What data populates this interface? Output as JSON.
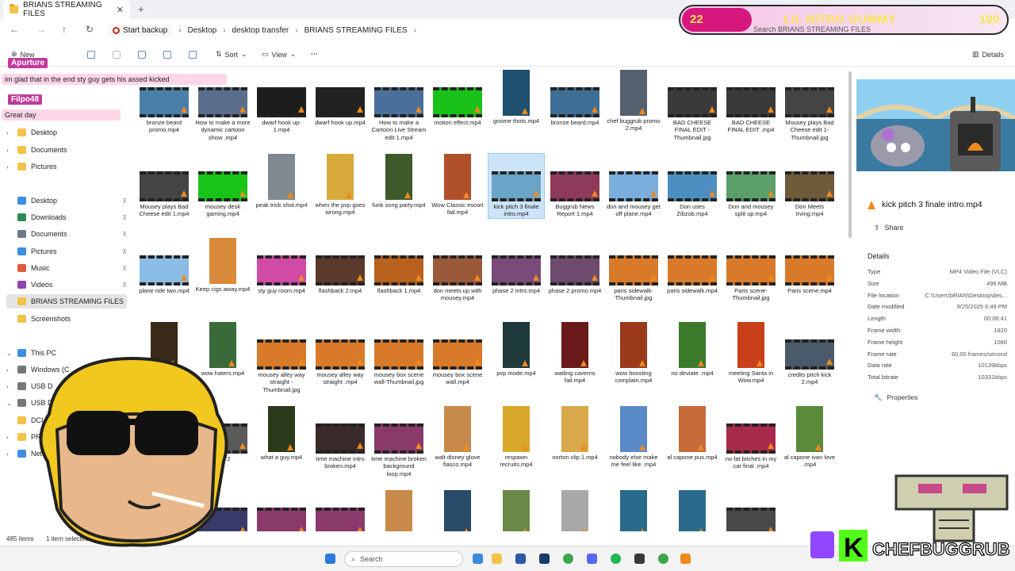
{
  "window": {
    "tab_title": "BRIANS STREAMING FILES",
    "close_glyph": "✕",
    "new_tab_glyph": "+"
  },
  "nav": {
    "back": "←",
    "forward": "→",
    "up": "↑",
    "refresh": "↻"
  },
  "breadcrumb": {
    "backup_label": "Start backup",
    "items": [
      "Desktop",
      "desktop transfer",
      "BRIANS STREAMING FILES"
    ],
    "sep": "›"
  },
  "toolbar": {
    "new_label": "New",
    "sort_label": "Sort",
    "view_label": "View",
    "more_label": "···",
    "details_label": "Details"
  },
  "overlay": {
    "gummy_left_num": "22",
    "gummy_title": "LIL NITRO GUMMY",
    "gummy_right_num": "100",
    "search_placeholder": "Search BRIANS STREAMING FILES",
    "chat": [
      {
        "user": "Apurture",
        "message": "im glad that in the end sty guy gets his assed kicked"
      },
      {
        "user": "Filpo48",
        "message": "Great day"
      }
    ],
    "brand": "CHEFBUGGRUB",
    "brand_k": "K"
  },
  "sidebar": {
    "items": [
      {
        "label": "Desktop",
        "chev": "›",
        "icon_color": "#f3c24a"
      },
      {
        "label": "Documents",
        "chev": "›",
        "icon_color": "#f3c24a"
      },
      {
        "label": "Pictures",
        "chev": "›",
        "icon_color": "#f3c24a"
      },
      {
        "label": "Desktop",
        "chev": "",
        "icon_color": "#3d8ee0",
        "pin": "📌"
      },
      {
        "label": "Downloads",
        "chev": "",
        "icon_color": "#2e8b57",
        "pin": "📌"
      },
      {
        "label": "Documents",
        "chev": "",
        "icon_color": "#6a7a8a",
        "pin": "📌"
      },
      {
        "label": "Pictures",
        "chev": "",
        "icon_color": "#3d8ee0",
        "pin": "📌"
      },
      {
        "label": "Music",
        "chev": "",
        "icon_color": "#e05a3d",
        "pin": "📌"
      },
      {
        "label": "Videos",
        "chev": "",
        "icon_color": "#8e44ad",
        "pin": "📌"
      },
      {
        "label": "BRIANS STREAMING FILES",
        "chev": "",
        "icon_color": "#f3c24a",
        "pin": ""
      },
      {
        "label": "Screenshots",
        "chev": "",
        "icon_color": "#f3c24a",
        "pin": ""
      },
      {
        "label": "This PC",
        "chev": "⌄",
        "icon_color": "#3d8ee0",
        "pin": ""
      },
      {
        "label": "Windows (C",
        "chev": "›",
        "icon_color": "#777777",
        "pin": ""
      },
      {
        "label": "USB D",
        "chev": "›",
        "icon_color": "#777777",
        "pin": ""
      },
      {
        "label": "USB D",
        "chev": "⌄",
        "icon_color": "#777777",
        "pin": ""
      },
      {
        "label": "DCI",
        "chev": "",
        "icon_color": "#f3c24a",
        "pin": ""
      },
      {
        "label": "PR",
        "chev": "›",
        "icon_color": "#f3c24a",
        "pin": ""
      },
      {
        "label": "Netw",
        "chev": "›",
        "icon_color": "#3d8ee0",
        "pin": ""
      }
    ]
  },
  "files": [
    {
      "name": "bronze beard promo.mp4",
      "color": "#4a7fa8",
      "tall": false
    },
    {
      "name": "How to make a more dynamic cartoon show .mp4",
      "color": "#5a6e8c",
      "tall": false
    },
    {
      "name": "dwarf hook up-1.mp4",
      "color": "#1d1d1d",
      "tall": false
    },
    {
      "name": "dwarf hook up.mp4",
      "color": "#222222",
      "tall": false
    },
    {
      "name": "How to make a Cartoon Live Stream edit 1.mp4",
      "color": "#4a6f9a",
      "tall": false
    },
    {
      "name": "motion effect.mp4",
      "color": "#19c219",
      "tall": false
    },
    {
      "name": "gnome thots.mp4",
      "color": "#1e4f6e",
      "tall": true
    },
    {
      "name": "bronze beard.mp4",
      "color": "#3d6f96",
      "tall": false
    },
    {
      "name": "chef buggrub promo 2.mp4",
      "color": "#55606e",
      "tall": true
    },
    {
      "name": "BAD CHEESE FINAL EDIT -Thumbnail.jpg",
      "color": "#3a3a3a",
      "tall": false
    },
    {
      "name": "BAD CHEESE FINAL EDIT .mp4",
      "color": "#3a3a3a",
      "tall": false
    },
    {
      "name": "Mousey plays Bad Cheese edit 1-Thumbnail.jpg",
      "color": "#444444",
      "tall": false
    },
    {
      "name": "Mousey plays Bad Cheese edit 1.mp4",
      "color": "#444444",
      "tall": false
    },
    {
      "name": "mousey desk gaming.mp4",
      "color": "#18c418",
      "tall": false
    },
    {
      "name": "peak trick shot.mp4",
      "color": "#7e8a90",
      "tall": true
    },
    {
      "name": "when the pvp goes wrong.mp4",
      "color": "#d6a93a",
      "tall": true
    },
    {
      "name": "funk song party.mp4",
      "color": "#3e5a2a",
      "tall": true
    },
    {
      "name": "Wow Classic escort fail.mp4",
      "color": "#b0502a",
      "tall": true
    },
    {
      "name": "kick pitch 3 finale intro.mp4",
      "color": "#6aa4c8",
      "tall": false
    },
    {
      "name": "Buggrub News Report 1.mp4",
      "color": "#8e3a5a",
      "tall": false
    },
    {
      "name": "don and mousey get off plane.mp4",
      "color": "#7aaedc",
      "tall": false
    },
    {
      "name": "Don uses Zibzob.mp4",
      "color": "#4d8fc0",
      "tall": false
    },
    {
      "name": "Don and mousey split up.mp4",
      "color": "#5a9f6a",
      "tall": false
    },
    {
      "name": "Don Meets Irving.mp4",
      "color": "#6e5a3a",
      "tall": false
    },
    {
      "name": "plane ride two.mp4",
      "color": "#8abce6",
      "tall": false
    },
    {
      "name": "Keep cigs away.mp4",
      "color": "#d88a3a",
      "tall": true
    },
    {
      "name": "sty guy room.mp4",
      "color": "#d04aa6",
      "tall": false
    },
    {
      "name": "flashback 2.mp4",
      "color": "#5a3a2a",
      "tall": false
    },
    {
      "name": "flashback 1.mp4",
      "color": "#b8601e",
      "tall": false
    },
    {
      "name": "don meets up with mousey.mp4",
      "color": "#9a5a3a",
      "tall": false
    },
    {
      "name": "phase 2 intro.mp4",
      "color": "#7a4a7a",
      "tall": false
    },
    {
      "name": "phase 2 promo.mp4",
      "color": "#6e4a6e",
      "tall": false
    },
    {
      "name": "paris sidewalk-Thumbnail.jpg",
      "color": "#d87a2a",
      "tall": false
    },
    {
      "name": "paris sidewalk.mp4",
      "color": "#d87a2a",
      "tall": false
    },
    {
      "name": "Paris scene-Thumbnail.jpg",
      "color": "#d87a2a",
      "tall": false
    },
    {
      "name": "Paris scene.mp4",
      "color": "#d87a2a",
      "tall": false
    },
    {
      "name": "",
      "color": "#3a2a1a",
      "tall": true
    },
    {
      "name": "wow haters.mp4",
      "color": "#3a6a3a",
      "tall": true
    },
    {
      "name": "mousey alley way straight -Thumbnail.jpg",
      "color": "#d87a2a",
      "tall": false
    },
    {
      "name": "mousey alley way straight .mp4",
      "color": "#d87a2a",
      "tall": false
    },
    {
      "name": "mousey box scene wall-Thumbnail.jpg",
      "color": "#d87a2a",
      "tall": false
    },
    {
      "name": "mousey box scene wall.mp4",
      "color": "#d87a2a",
      "tall": false
    },
    {
      "name": "pvp mode.mp4",
      "color": "#1e3a3a",
      "tall": true
    },
    {
      "name": "wailing caverns fail.mp4",
      "color": "#6a1a1a",
      "tall": true
    },
    {
      "name": "wow boosting complain.mp4",
      "color": "#9a3a1a",
      "tall": true
    },
    {
      "name": "no deviate .mp4",
      "color": "#3a7a2a",
      "tall": true
    },
    {
      "name": "meeting Santa in Wow.mp4",
      "color": "#c8401a",
      "tall": true
    },
    {
      "name": "credits pitch kick 2.mp4",
      "color": "#4a5a6a",
      "tall": false
    },
    {
      "name": "",
      "color": "#3a3a3a",
      "tall": true
    },
    {
      "name": "kick 2",
      "color": "#5a5a5a",
      "tall": false
    },
    {
      "name": "what a guy.mp4",
      "color": "#2a3a1a",
      "tall": true
    },
    {
      "name": "time machine intro broken.mp4",
      "color": "#3a2a2a",
      "tall": false
    },
    {
      "name": "time machine broken background loop.mp4",
      "color": "#8a3a6a",
      "tall": false
    },
    {
      "name": "walt disney glove fiasco.mp4",
      "color": "#c88a4a",
      "tall": true
    },
    {
      "name": "respawn recruits.mp4",
      "color": "#d8a82a",
      "tall": true
    },
    {
      "name": "norton clip 1.mp4",
      "color": "#d8a84a",
      "tall": true
    },
    {
      "name": "nobody else make me feel like .mp4",
      "color": "#5a8ac8",
      "tall": true
    },
    {
      "name": "al capone pus.mp4",
      "color": "#c86a3a",
      "tall": true
    },
    {
      "name": "no fat bitches in my car final .mp4",
      "color": "#a82a4a",
      "tall": false
    },
    {
      "name": "al capone ivan love .mp4",
      "color": "#5a8a3a",
      "tall": true
    },
    {
      "name": "",
      "color": "#4a4a4a",
      "tall": false
    },
    {
      "name": "",
      "color": "#3a3a6a",
      "tall": false
    },
    {
      "name": "",
      "color": "#8a3a6a",
      "tall": false
    },
    {
      "name": "",
      "color": "#8a3a6a",
      "tall": false
    },
    {
      "name": "",
      "color": "#c88a4a",
      "tall": true
    },
    {
      "name": "",
      "color": "#2a4a6a",
      "tall": true
    },
    {
      "name": "",
      "color": "#6a8a4a",
      "tall": true
    },
    {
      "name": "",
      "color": "#a8a8a8",
      "tall": true
    },
    {
      "name": "",
      "color": "#2a6a8a",
      "tall": true
    },
    {
      "name": "",
      "color": "#2a6a8a",
      "tall": true
    },
    {
      "name": "",
      "color": "#4a4a4a",
      "tall": false
    }
  ],
  "selected_file_index": 18,
  "details": {
    "file_name": "kick pitch 3 finale intro.mp4",
    "share_label": "Share",
    "header": "Details",
    "rows": [
      {
        "k": "Type",
        "v": "MP4 Video File (VLC)"
      },
      {
        "k": "Size",
        "v": "496 MB"
      },
      {
        "k": "File location",
        "v": "C:\\Users\\bRIAN\\Desktop\\des..."
      },
      {
        "k": "Date modified",
        "v": "9/25/2025 6:49 PM"
      },
      {
        "k": "Length",
        "v": "00:06:41"
      },
      {
        "k": "Frame width",
        "v": "1920"
      },
      {
        "k": "Frame height",
        "v": "1080"
      },
      {
        "k": "Frame rate",
        "v": "60.00 frames/second"
      },
      {
        "k": "Data rate",
        "v": "10139kbps"
      },
      {
        "k": "Total bitrate",
        "v": "10331kbps"
      }
    ],
    "properties_label": "Properties"
  },
  "status": {
    "count": "485 items",
    "selected": "1 item selected"
  },
  "taskbar": {
    "search_label": "Search"
  }
}
